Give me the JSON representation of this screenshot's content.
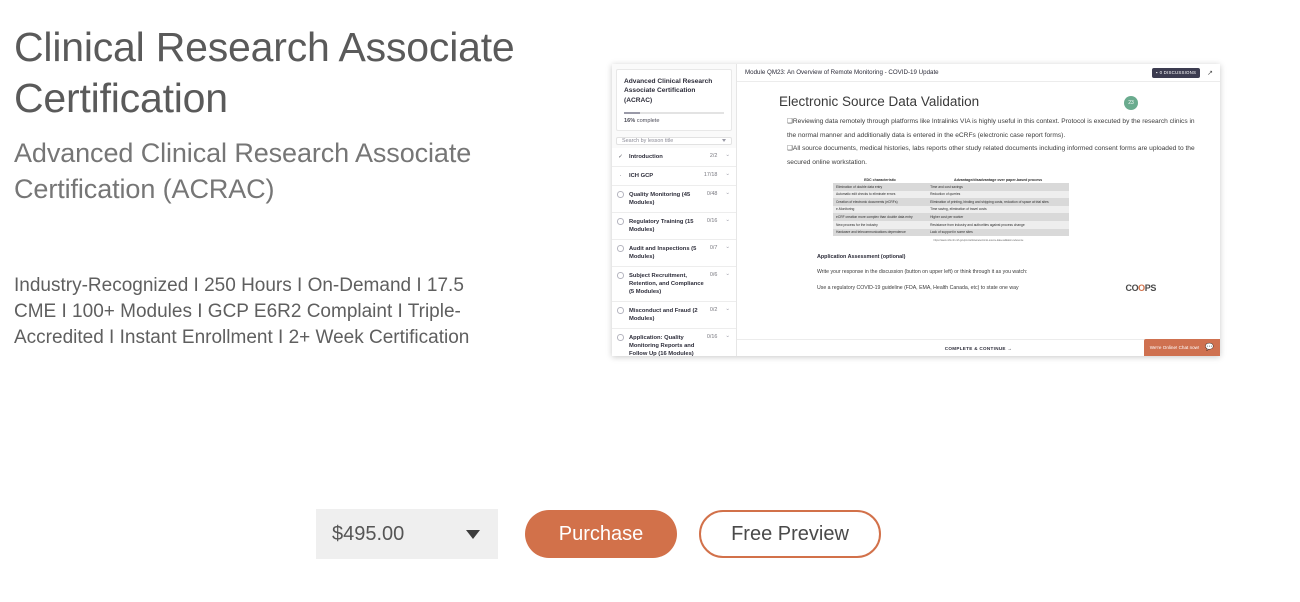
{
  "hero": {
    "title": "Clinical Research Associate Certification",
    "subtitle": "Advanced Clinical Research Associate Certification (ACRAC)",
    "highlights": "Industry-Recognized I 250 Hours I On-Demand I 17.5 CME I 100+ Modules I GCP E6R2 Complaint I Triple-Accredited I Instant Enrollment I 2+ Week Certification"
  },
  "purchase": {
    "price": "$495.00",
    "purchase_label": "Purchase",
    "preview_label": "Free Preview",
    "accent_color": "#d2714a",
    "select_background": "#efefef"
  },
  "preview": {
    "sidebar": {
      "course_title": "Advanced Clinical Research Associate Certification (ACRAC)",
      "progress_percent": "16%",
      "progress_label": "complete",
      "search_placeholder": "Search by lesson title",
      "lessons": [
        {
          "icon": "check",
          "label": "Introduction",
          "count": "2/2"
        },
        {
          "icon": "partial",
          "label": "ICH GCP",
          "count": "17/18"
        },
        {
          "icon": "circle",
          "label": "Quality Monitoring (45 Modules)",
          "count": "0/48"
        },
        {
          "icon": "circle",
          "label": "Regulatory Training (15 Modules)",
          "count": "0/16"
        },
        {
          "icon": "circle",
          "label": "Audit and Inspections (5 Modules)",
          "count": "0/7"
        },
        {
          "icon": "circle",
          "label": "Subject Recruitment, Retention, and Compliance (5 Modules)",
          "count": "0/6"
        },
        {
          "icon": "circle",
          "label": "Misconduct and Fraud (2 Modules)",
          "count": "0/2"
        },
        {
          "icon": "circle",
          "label": "Application: Quality Monitoring Reports and Follow Up (16 Modules)",
          "count": "0/16"
        }
      ]
    },
    "topbar": {
      "module_title": "Module QM23: An Overview of Remote Monitoring - COVID-19 Update",
      "discussions_label": "0 DISCUSSIONS",
      "discussions_icon": "comment-icon",
      "expand_icon": "expand-icon"
    },
    "slide": {
      "title": "Electronic Source Data Validation",
      "page_number": "23",
      "bullets": [
        "Reviewing data remotely through platforms like Intralinks VIA is highly useful in  this context. Protocol is executed by the research clinics in the normal manner and  additionally data is entered in the eCRFs (electronic case report forms).",
        "All source documents, medical histories, labs reports other study related documents including informed consent forms are uploaded to the secured online workstation."
      ],
      "table": {
        "headers": [
          "EDC characteristic",
          "Advantage/disadvantage over paper-based process"
        ],
        "rows": [
          [
            "Elimination of double data entry",
            "Time and cost savings"
          ],
          [
            "Automatic edit checks to eliminate errors",
            "Reduction of queries"
          ],
          [
            "Creation of electronic documents (eCRFs)",
            "Elimination of printing, binding and shipping costs, reduction of space at trial sites"
          ],
          [
            "e-Monitoring",
            "Time saving, elimination of travel costs"
          ],
          [
            "eCRF creation more complex than double data entry",
            "Higher cost per worker"
          ],
          [
            "New process for the industry",
            "Resistance from industry and authorities against process change"
          ],
          [
            "Hardware and telecommunications dependence",
            "Lack of support in some sites"
          ]
        ],
        "source": "https://www.ncbi.nlm.nih.gov/pmc/articles/electronic-source-data-validation-reference"
      },
      "logo_text_1": "CO",
      "logo_text_2": "O",
      "logo_text_3": "PS",
      "assessment": {
        "title": "Application Assessment (optional)",
        "line1": "Write your response in the discussion (button on upper left) or think through it as you watch:",
        "line2": "Use a regulatory COVID-19 guideline (FDA, EMA, Health Canada, etc) to state one way"
      }
    },
    "footer": {
      "continue_label": "COMPLETE & CONTINUE  →"
    },
    "chat": {
      "label": "We're Online! Chat now!",
      "icon": "chat-bubble-icon",
      "color": "#cf7150"
    }
  }
}
